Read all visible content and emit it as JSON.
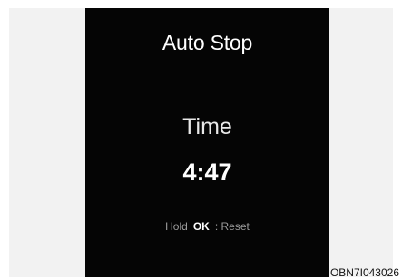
{
  "display": {
    "title": "Auto Stop",
    "time_label": "Time",
    "time_value": "4:47",
    "hint": {
      "hold": "Hold",
      "key": "OK",
      "action": ": Reset"
    }
  },
  "figure_code": "OBN7I043026",
  "colors": {
    "screen_background": "#050505",
    "frame_background": "#f2f2f2",
    "text": "#ffffff",
    "hint_text": "#9c9c9c"
  }
}
